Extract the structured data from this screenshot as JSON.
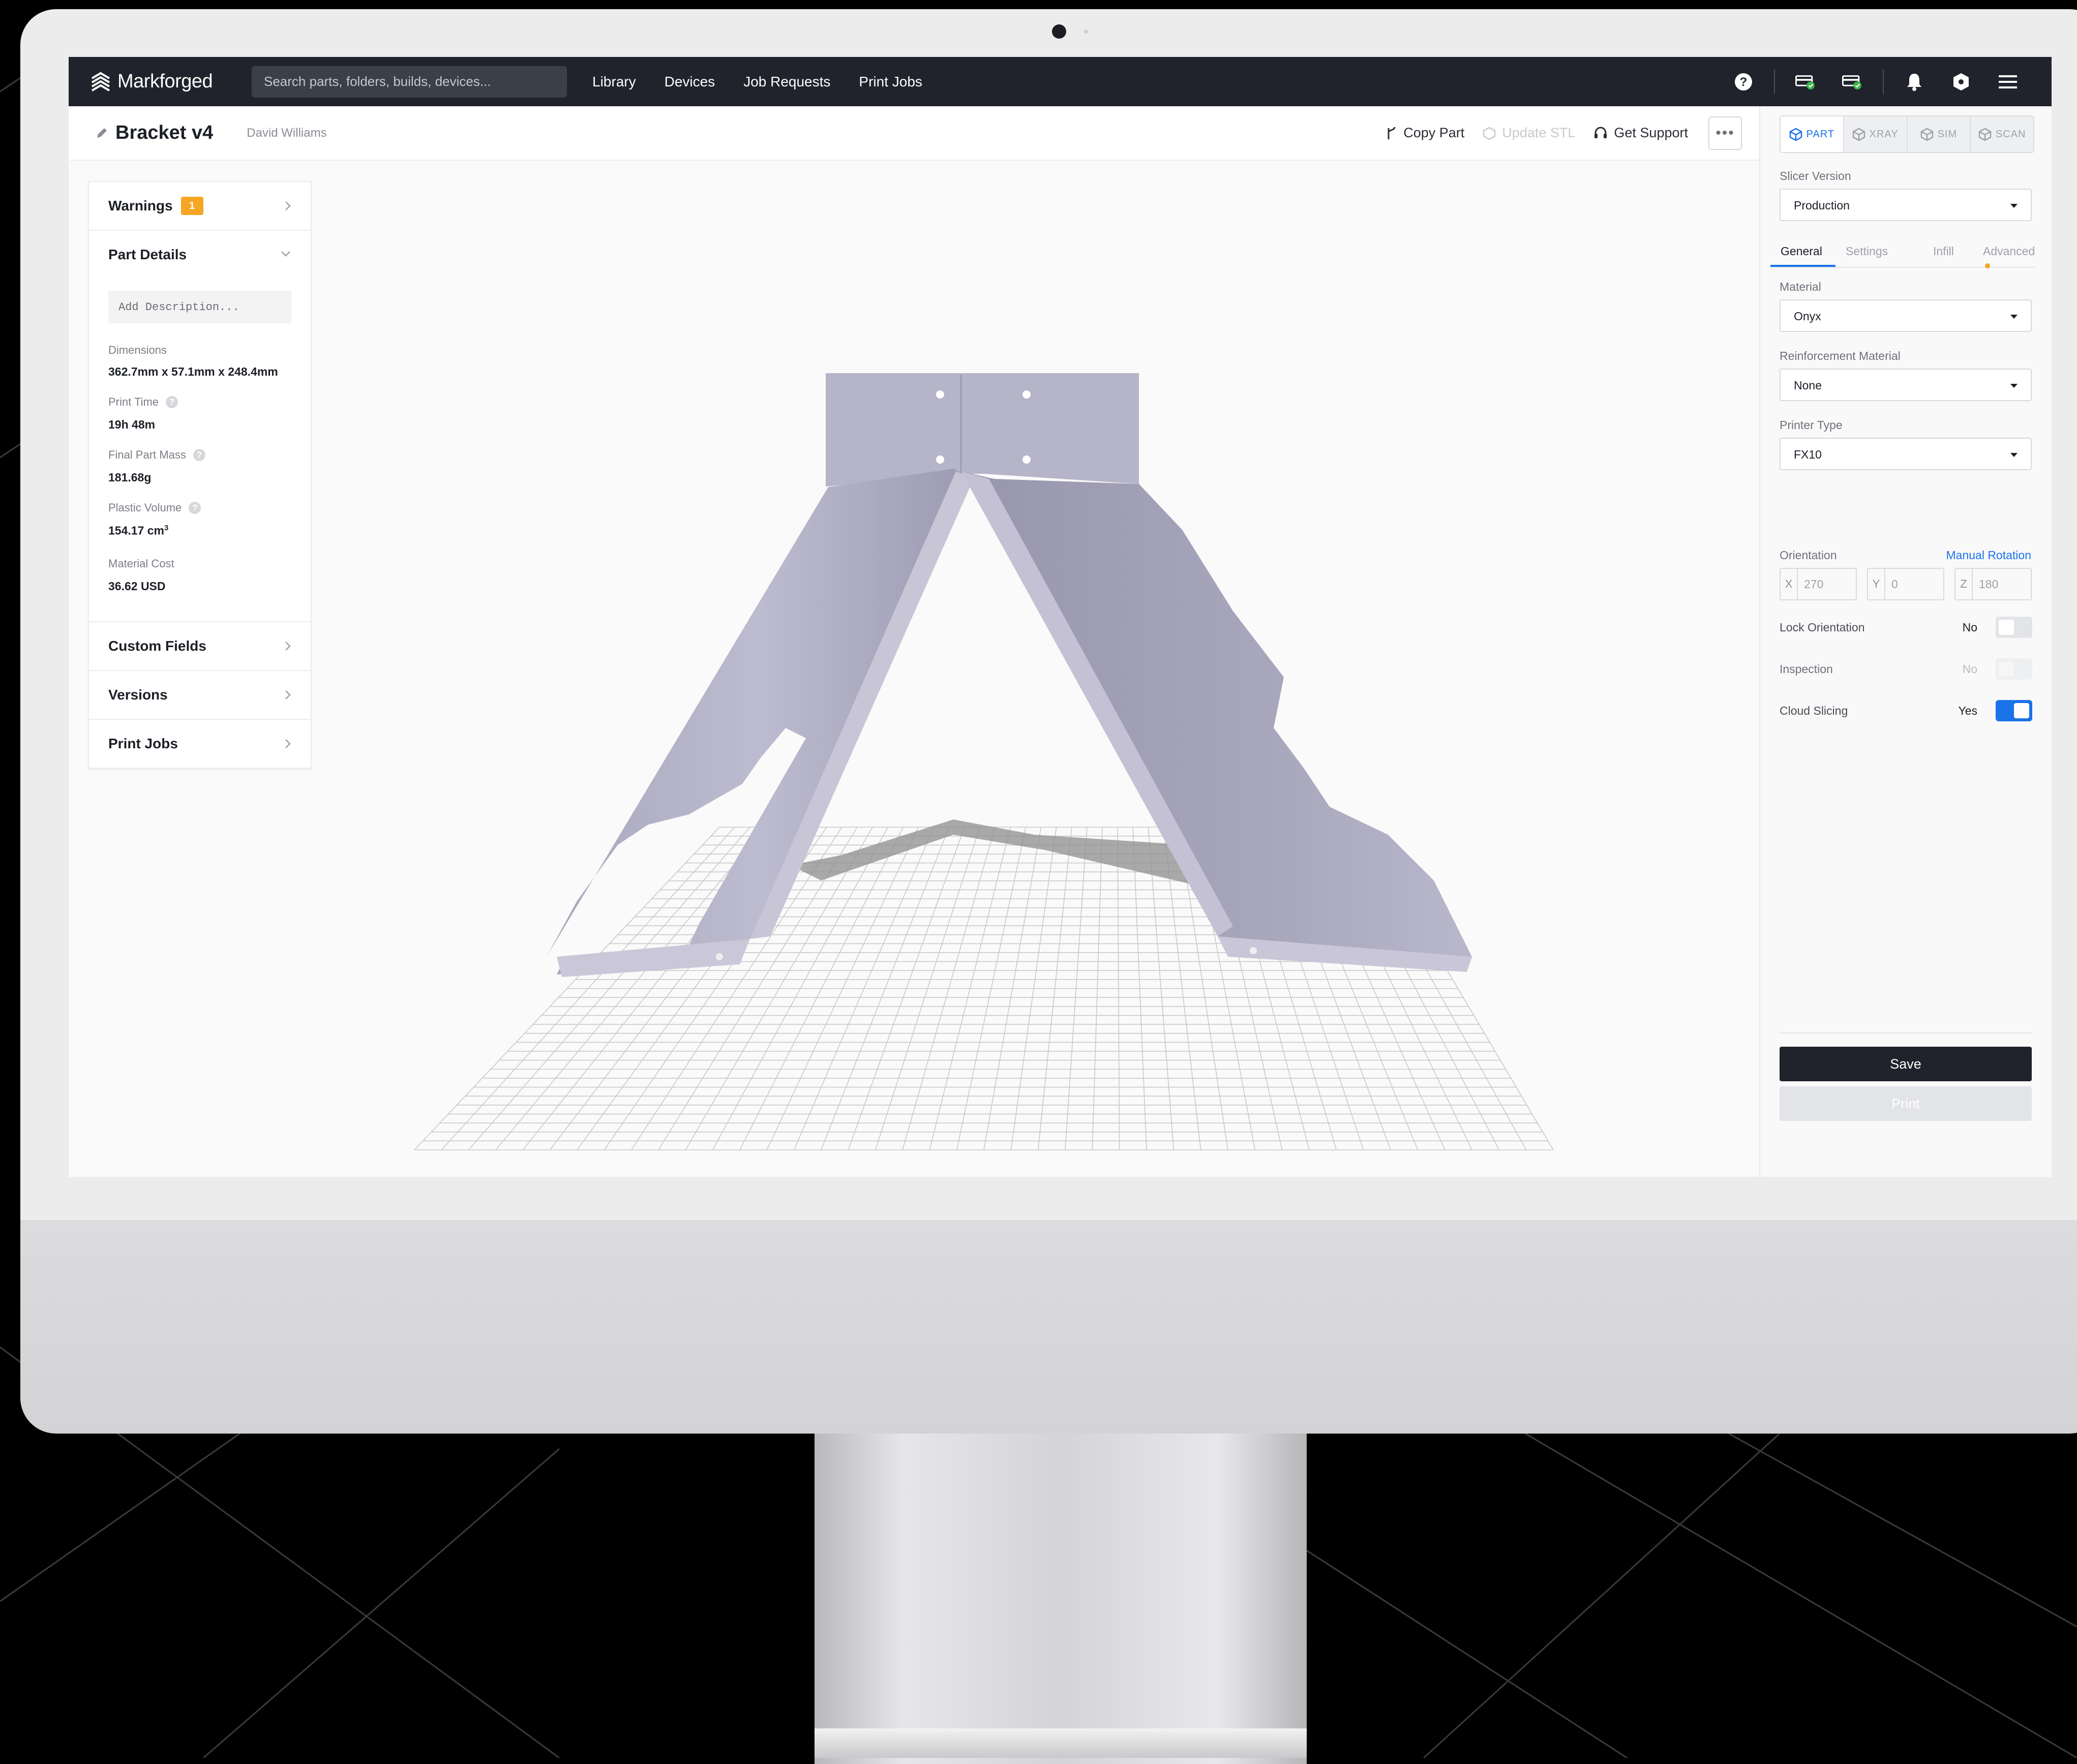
{
  "app": {
    "logo_text": "Markforged",
    "search_placeholder": "Search parts, folders, builds, devices...",
    "nav_links": [
      "Library",
      "Devices",
      "Job Requests",
      "Print Jobs"
    ],
    "nav_icons": [
      "help-icon",
      "printer-status-icon",
      "printer-status-icon",
      "bell-icon",
      "hexagon-icon",
      "menu-icon"
    ]
  },
  "part": {
    "title": "Bracket v4",
    "author": "David Williams"
  },
  "actions": {
    "copy_part": "Copy Part",
    "update_stl": "Update STL",
    "get_support": "Get Support",
    "more": "•••"
  },
  "left_panel": {
    "warnings_label": "Warnings",
    "warnings_count": "1",
    "part_details_label": "Part Details",
    "description_placeholder": "Add Description...",
    "details": [
      {
        "label": "Dimensions",
        "value": "362.7mm x 57.1mm x 248.4mm",
        "help": false
      },
      {
        "label": "Print Time",
        "value": "19h 48m",
        "help": true
      },
      {
        "label": "Final Part Mass",
        "value": "181.68g",
        "help": true
      },
      {
        "label": "Plastic Volume",
        "value": "154.17 cm",
        "sup": "3",
        "help": true
      },
      {
        "label": "Material Cost",
        "value": "36.62 USD",
        "help": false
      }
    ],
    "custom_fields_label": "Custom Fields",
    "versions_label": "Versions",
    "print_jobs_label": "Print Jobs"
  },
  "right_panel": {
    "mode_tabs": [
      "PART",
      "XRAY",
      "SIM",
      "SCAN"
    ],
    "active_mode": "PART",
    "slicer_version_label": "Slicer Version",
    "slicer_version_value": "Production",
    "sub_tabs": [
      "General",
      "Settings",
      "Infill",
      "Advanced"
    ],
    "active_sub_tab": "General",
    "material_label": "Material",
    "material_value": "Onyx",
    "reinforcement_label": "Reinforcement Material",
    "reinforcement_value": "None",
    "printer_type_label": "Printer Type",
    "printer_type_value": "FX10",
    "orientation_label": "Orientation",
    "manual_rotation_label": "Manual Rotation",
    "orientation": {
      "x": "270",
      "y": "0",
      "z": "180"
    },
    "axis_labels": {
      "x": "X",
      "y": "Y",
      "z": "Z"
    },
    "lock_orientation_label": "Lock Orientation",
    "lock_orientation_value": "No",
    "inspection_label": "Inspection",
    "inspection_value": "No",
    "cloud_slicing_label": "Cloud Slicing",
    "cloud_slicing_value": "Yes",
    "save_label": "Save",
    "print_label": "Print"
  },
  "colors": {
    "nav_bg": "#20232b",
    "accent_blue": "#1a73e8",
    "warning_orange": "#f5a623",
    "part_color": "#b4b2c6"
  }
}
